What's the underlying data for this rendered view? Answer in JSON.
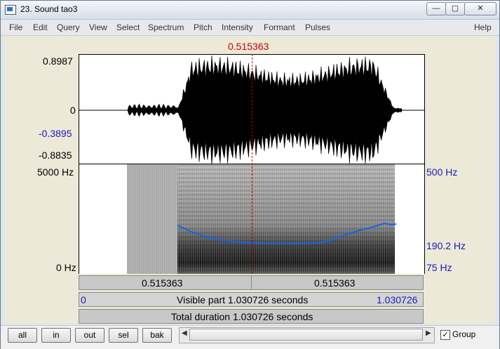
{
  "window": {
    "title": "23. Sound tao3",
    "minimize": "—",
    "maximize": "▢",
    "close": "✕"
  },
  "menu": [
    "File",
    "Edit",
    "Query",
    "View",
    "Select",
    "Spectrum",
    "Pitch",
    "Intensity",
    "Formant",
    "Pulses"
  ],
  "help": "Help",
  "cursor_time": "0.515363",
  "waveform": {
    "max": "0.8987",
    "zero": "0",
    "cursor_value": "-0.3895",
    "min": "-0.8835"
  },
  "spectrogram": {
    "freq_max": "5000 Hz",
    "freq_min": "0 Hz"
  },
  "pitch": {
    "max": "500 Hz",
    "cursor": "190.2 Hz",
    "min": "75 Hz",
    "color": "#1565e6"
  },
  "time_bar": {
    "left": "0.515363",
    "right": "0.515363"
  },
  "visible_bar": {
    "start": "0",
    "label": "Visible part 1.030726 seconds",
    "end": "1.030726"
  },
  "total_bar": {
    "label": "Total duration 1.030726 seconds"
  },
  "buttons": [
    "all",
    "in",
    "out",
    "sel",
    "bak"
  ],
  "group": {
    "label": "Group",
    "checked": true
  }
}
